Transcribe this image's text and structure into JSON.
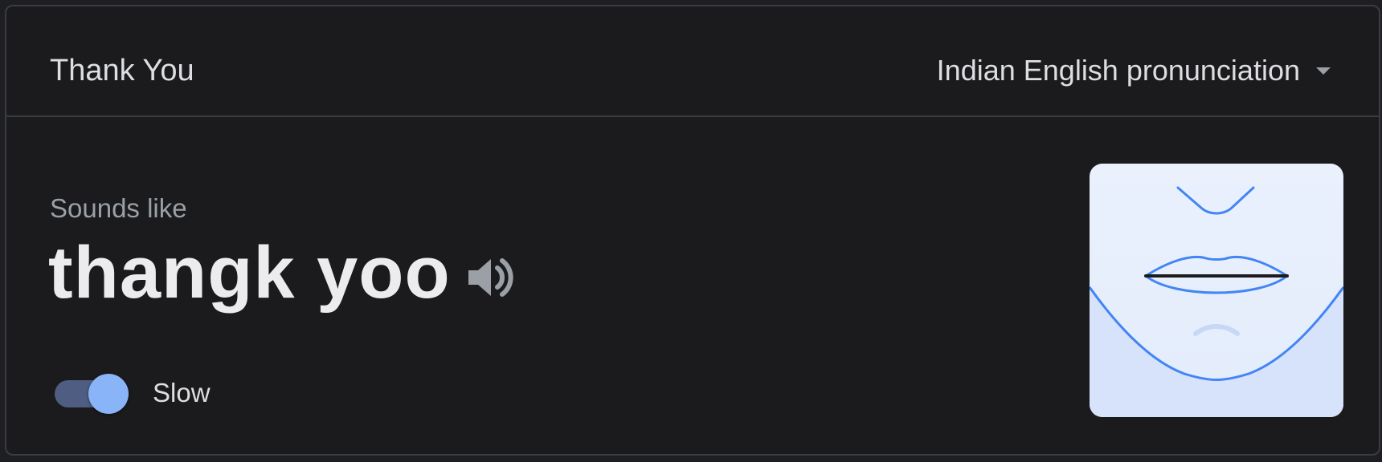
{
  "header": {
    "title": "Thank You",
    "language": "Indian English pronunciation"
  },
  "pronunciation": {
    "sounds_like_label": "Sounds like",
    "phonetic": "thangk yoo"
  },
  "controls": {
    "slow_label": "Slow",
    "slow_enabled": true
  },
  "icons": {
    "dropdown": "chevron-down-icon",
    "speaker": "speaker-icon",
    "mouth_illustration": "mouth-illustration"
  },
  "colors": {
    "background": "#1b1b1d",
    "border": "#3b3c40",
    "accent": "#8ab4f8",
    "illustration_line": "#4285f4",
    "illustration_bg": "#e8f0fe"
  }
}
